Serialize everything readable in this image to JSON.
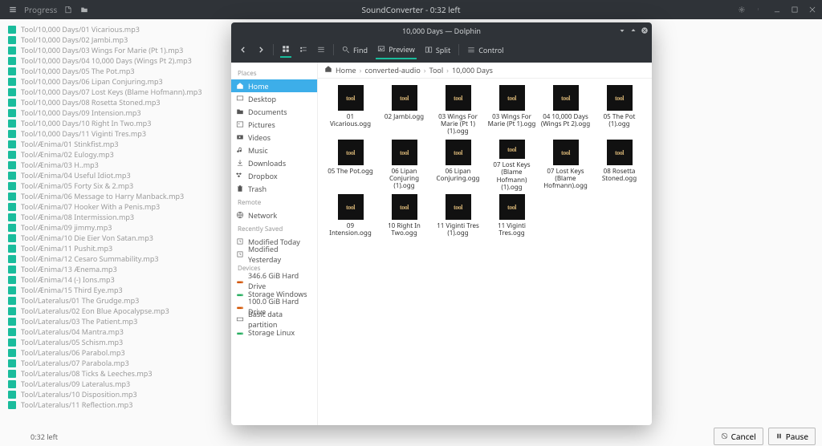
{
  "titlebar": {
    "main_title": "SoundConverter - 0:32 left",
    "progress": "Progress"
  },
  "conversion_rows": [
    "Tool/10,000 Days/01 Vicarious.mp3",
    "Tool/10,000 Days/02 Jambi.mp3",
    "Tool/10,000 Days/03 Wings For Marie (Pt 1).mp3",
    "Tool/10,000 Days/04 10,000 Days (Wings Pt 2).mp3",
    "Tool/10,000 Days/05 The Pot.mp3",
    "Tool/10,000 Days/06 Lipan Conjuring.mp3",
    "Tool/10,000 Days/07 Lost Keys (Blame Hofmann).mp3",
    "Tool/10,000 Days/08 Rosetta Stoned.mp3",
    "Tool/10,000 Days/09 Intension.mp3",
    "Tool/10,000 Days/10 Right In Two.mp3",
    "Tool/10,000 Days/11 Viginti Tres.mp3",
    "Tool/Ænima/01 Stinkfist.mp3",
    "Tool/Ænima/02 Eulogy.mp3",
    "Tool/Ænima/03 H..mp3",
    "Tool/Ænima/04 Useful Idiot.mp3",
    "Tool/Ænima/05 Forty Six & 2.mp3",
    "Tool/Ænima/06 Message to Harry Manback.mp3",
    "Tool/Ænima/07 Hooker With a Penis.mp3",
    "Tool/Ænima/08 Intermission.mp3",
    "Tool/Ænima/09 jimmy.mp3",
    "Tool/Ænima/10 Die Eier Von Satan.mp3",
    "Tool/Ænima/11 Pushit.mp3",
    "Tool/Ænima/12 Cesaro Summability.mp3",
    "Tool/Ænima/13 Ænema.mp3",
    "Tool/Ænima/14 (-) Ions.mp3",
    "Tool/Ænima/15 Third Eye.mp3",
    "Tool/Lateralus/01 The Grudge.mp3",
    "Tool/Lateralus/02 Eon Blue Apocalypse.mp3",
    "Tool/Lateralus/03 The Patient.mp3",
    "Tool/Lateralus/04 Mantra.mp3",
    "Tool/Lateralus/05 Schism.mp3",
    "Tool/Lateralus/06 Parabol.mp3",
    "Tool/Lateralus/07 Parabola.mp3",
    "Tool/Lateralus/08 Ticks & Leeches.mp3",
    "Tool/Lateralus/09 Lateralus.mp3",
    "Tool/Lateralus/10 Disposition.mp3",
    "Tool/Lateralus/11 Reflection.mp3"
  ],
  "bottom": {
    "time": "0:32 left",
    "cancel": "Cancel",
    "pause": "Pause"
  },
  "dolphin": {
    "title": "10,000 Days — Dolphin",
    "toolbar": {
      "find": "Find",
      "preview": "Preview",
      "split": "Split",
      "control": "Control"
    },
    "breadcrumb": [
      "Home",
      "converted-audio",
      "Tool",
      "10,000 Days"
    ],
    "places": {
      "sec1": "Places",
      "items1": [
        "Home",
        "Desktop",
        "Documents",
        "Pictures",
        "Videos",
        "Music",
        "Downloads",
        "Dropbox",
        "Trash"
      ],
      "sec2": "Remote",
      "items2": [
        "Network"
      ],
      "sec3": "Recently Saved",
      "items3": [
        "Modified Today",
        "Modified Yesterday"
      ],
      "sec4": "Devices",
      "items4": [
        "346.6 GiB Hard Drive",
        "Storage Windows",
        "100.0 GiB Hard Drive",
        "Basic data partition",
        "Storage Linux"
      ]
    },
    "files": [
      "01 Vicarious.ogg",
      "02 Jambi.ogg",
      "03 Wings For Marie (Pt 1) (1).ogg",
      "03 Wings For Marie (Pt 1).ogg",
      "04 10,000 Days (Wings Pt 2).ogg",
      "05 The Pot (1).ogg",
      "05 The Pot.ogg",
      "06 Lipan Conjuring (1).ogg",
      "06 Lipan Conjuring.ogg",
      "07 Lost Keys (Blame Hofmann) (1).ogg",
      "07 Lost Keys (Blame Hofmann).ogg",
      "08 Rosetta Stoned.ogg",
      "09 Intension.ogg",
      "10 Right In Two.ogg",
      "11 Viginti Tres (1).ogg",
      "11 Viginti Tres.ogg"
    ],
    "thumb_text": "tool"
  }
}
